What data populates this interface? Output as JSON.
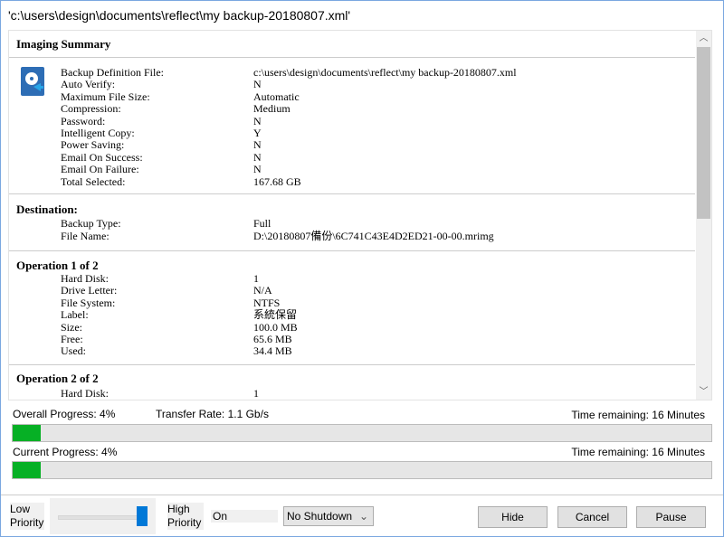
{
  "window": {
    "title": "'c:\\users\\design\\documents\\reflect\\my backup-20180807.xml'"
  },
  "summary": {
    "heading": "Imaging Summary",
    "rows": [
      {
        "label": "Backup Definition File:",
        "value": "c:\\users\\design\\documents\\reflect\\my backup-20180807.xml"
      },
      {
        "label": "Auto Verify:",
        "value": "N"
      },
      {
        "label": "Maximum File Size:",
        "value": "Automatic"
      },
      {
        "label": "Compression:",
        "value": "Medium"
      },
      {
        "label": "Password:",
        "value": "N"
      },
      {
        "label": "Intelligent Copy:",
        "value": "Y"
      },
      {
        "label": "Power Saving:",
        "value": "N"
      },
      {
        "label": "Email On Success:",
        "value": "N"
      },
      {
        "label": "Email On Failure:",
        "value": "N"
      },
      {
        "label": "Total Selected:",
        "value": "167.68 GB"
      }
    ]
  },
  "destination": {
    "heading": "Destination:",
    "rows": [
      {
        "label": "Backup Type:",
        "value": "Full"
      },
      {
        "label": "File Name:",
        "value": "D:\\20180807備份\\6C741C43E4D2ED21-00-00.mrimg"
      }
    ]
  },
  "op1": {
    "heading": "Operation 1 of 2",
    "rows": [
      {
        "label": "Hard Disk:",
        "value": "1"
      },
      {
        "label": "Drive Letter:",
        "value": "N/A"
      },
      {
        "label": "File System:",
        "value": "NTFS"
      },
      {
        "label": "Label:",
        "value": "系統保留"
      },
      {
        "label": "Size:",
        "value": "100.0 MB"
      },
      {
        "label": "Free:",
        "value": "65.6 MB"
      },
      {
        "label": "Used:",
        "value": "34.4 MB"
      }
    ]
  },
  "op2": {
    "heading": "Operation 2 of 2",
    "rows": [
      {
        "label": "Hard Disk:",
        "value": "1"
      }
    ]
  },
  "progress": {
    "overall_label": "Overall Progress:  4%",
    "overall_percent": 4,
    "transfer_rate": "Transfer Rate: 1.1 Gb/s",
    "overall_remaining": "Time remaining: 16 Minutes",
    "current_label": "Current Progress:  4%",
    "current_percent": 4,
    "current_remaining": "Time remaining: 16 Minutes"
  },
  "footer": {
    "low": "Low Priority",
    "high": "High Priority",
    "priority_level": 1.0,
    "on": "On",
    "shutdown": "No Shutdown",
    "hide": "Hide",
    "cancel": "Cancel",
    "pause": "Pause"
  }
}
